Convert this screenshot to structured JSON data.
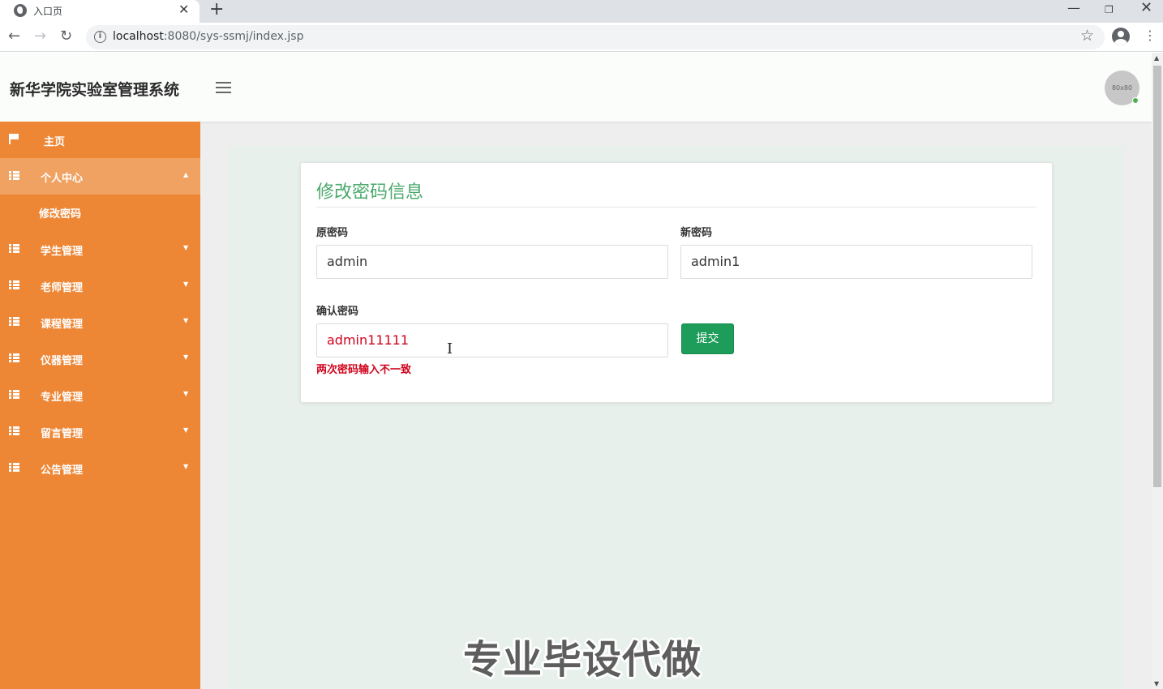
{
  "browser": {
    "tab_title": "入口页",
    "url_host": "localhost",
    "url_rest": ":8080/sys-ssmj/index.jsp"
  },
  "header": {
    "brand": "新华学院实验室管理系统",
    "avatar_text": "80x80"
  },
  "sidebar": {
    "items": [
      {
        "label": "主页",
        "icon": "flag-icon"
      },
      {
        "label": "个人中心",
        "icon": "grid-icon",
        "expanded": true
      },
      {
        "label": "学生管理",
        "icon": "grid-icon"
      },
      {
        "label": "老师管理",
        "icon": "grid-icon"
      },
      {
        "label": "课程管理",
        "icon": "grid-icon"
      },
      {
        "label": "仪器管理",
        "icon": "grid-icon"
      },
      {
        "label": "专业管理",
        "icon": "grid-icon"
      },
      {
        "label": "留言管理",
        "icon": "grid-icon"
      },
      {
        "label": "公告管理",
        "icon": "grid-icon"
      }
    ],
    "subitem": "修改密码"
  },
  "form": {
    "title": "修改密码信息",
    "old_label": "原密码",
    "old_value": "admin",
    "new_label": "新密码",
    "new_value": "admin1",
    "confirm_label": "确认密码",
    "confirm_value": "admin11111",
    "error": "两次密码输入不一致",
    "submit": "提交"
  },
  "watermark": "专业毕设代做",
  "colors": {
    "sidebar": "#ed8736",
    "accent_green": "#1e9c5a",
    "title_green": "#4aa96c",
    "error_red": "#d0021b"
  }
}
